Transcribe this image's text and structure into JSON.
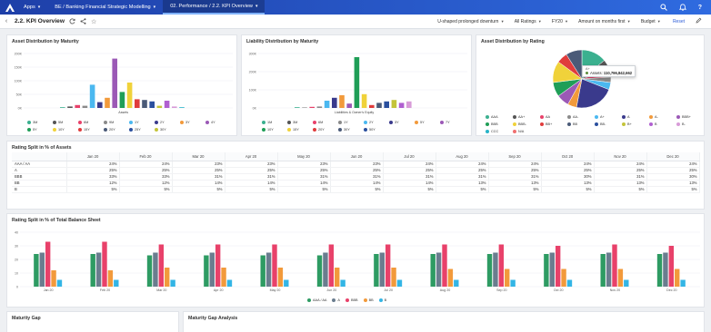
{
  "topbar": {
    "apps_label": "Apps",
    "breadcrumb_1": "BE / Banking Financial Strategic Modelling",
    "breadcrumb_2": "02. Performance / 2.2. KPI Overview",
    "icons": [
      "search-icon",
      "bell-icon",
      "help-icon"
    ]
  },
  "toolbar": {
    "title": "2.2. KPI Overview",
    "filters": [
      "U-shaped prolonged downturn",
      "All Ratings",
      "FY20",
      "Amount on months first",
      "Budget"
    ],
    "reset_label": "Reset"
  },
  "colors": {
    "palette": [
      "#3bb08f",
      "#555555",
      "#e8416a",
      "#8a8a8a",
      "#4bb8f0",
      "#3a3a8c",
      "#f29a3b",
      "#9b59b6",
      "#1f9e57",
      "#f0d23a",
      "#e03c3c",
      "#4a5a78",
      "#2a4f9e",
      "#c4c43a",
      "#b05fd0",
      "#d89bd8",
      "#28b4c8",
      "#f07070"
    ],
    "balance": [
      "#2e9b63",
      "#6a7d8f",
      "#e8416a",
      "#f29a3b",
      "#33b5e5"
    ]
  },
  "asset_maturity": {
    "title": "Asset Distribution by Maturity",
    "y_ticks": [
      "200K",
      "150K",
      "100K",
      "50K",
      "0K"
    ],
    "x_label": "Assets",
    "values": [
      1,
      2,
      4,
      3,
      32,
      8,
      14,
      68,
      22,
      35,
      12,
      11,
      9,
      3,
      10,
      2,
      1
    ],
    "legend": [
      "3M",
      "5M",
      "6M",
      "9M",
      "1Y",
      "2Y",
      "3Y",
      "4Y",
      "5Y",
      "10Y",
      "15Y",
      "20Y",
      "25Y",
      "30Y"
    ]
  },
  "liability_maturity": {
    "title": "Liability Distribution by Maturity",
    "y_ticks": [
      "300K",
      "200K",
      "100K",
      "0K"
    ],
    "x_label": "Liabilities & Owner's Equity",
    "values": [
      2,
      1,
      3,
      4,
      20,
      28,
      35,
      12,
      140,
      38,
      8,
      14,
      18,
      22,
      14,
      18
    ],
    "legend": [
      "1M",
      "3M",
      "6M",
      "1Y",
      "2Y",
      "3Y",
      "5Y",
      "7Y",
      "10Y",
      "15Y",
      "20Y",
      "30Y",
      "50Y"
    ]
  },
  "asset_rating": {
    "title": "Asset Distribution by Rating",
    "slices": [
      14,
      6,
      4,
      3,
      4,
      22,
      5,
      7,
      8,
      12,
      6,
      9
    ],
    "legend": [
      "AAA",
      "AA+",
      "AA",
      "AA-",
      "A+",
      "A",
      "A-",
      "BBB+",
      "BBB",
      "BBB-",
      "BB+",
      "BB",
      "BB-",
      "B+",
      "B",
      "B-",
      "CCC",
      "N/A"
    ],
    "tooltip_head": "A+",
    "tooltip_label": "Assets:",
    "tooltip_value": "110,796,842,662"
  },
  "rating_split_assets": {
    "title": "Rating Split in % of Assets",
    "columns": [
      "Jan 20",
      "Feb 20",
      "Mar 20",
      "Apr 20",
      "May 20",
      "Jun 20",
      "Jul 20",
      "Aug 20",
      "Sep 20",
      "Oct 20",
      "Nov 20",
      "Dec 20"
    ],
    "rows": [
      {
        "label": "AAA / AA",
        "values": [
          "24%",
          "24%",
          "23%",
          "23%",
          "23%",
          "23%",
          "24%",
          "24%",
          "24%",
          "24%",
          "24%",
          "24%"
        ]
      },
      {
        "label": "A",
        "values": [
          "25%",
          "25%",
          "25%",
          "25%",
          "25%",
          "25%",
          "25%",
          "25%",
          "25%",
          "25%",
          "25%",
          "25%"
        ]
      },
      {
        "label": "BBB",
        "values": [
          "33%",
          "33%",
          "31%",
          "31%",
          "31%",
          "31%",
          "31%",
          "31%",
          "31%",
          "30%",
          "31%",
          "30%"
        ]
      },
      {
        "label": "BB",
        "values": [
          "12%",
          "12%",
          "14%",
          "14%",
          "14%",
          "14%",
          "14%",
          "13%",
          "13%",
          "13%",
          "13%",
          "13%"
        ]
      },
      {
        "label": "B",
        "values": [
          "5%",
          "5%",
          "5%",
          "5%",
          "5%",
          "5%",
          "5%",
          "5%",
          "5%",
          "5%",
          "5%",
          "5%"
        ]
      }
    ]
  },
  "balance_sheet": {
    "title": "Rating Split in % of Total Balance Sheet",
    "y_ticks": [
      "40",
      "30",
      "20",
      "10",
      "0"
    ],
    "ylim": [
      0,
      40
    ],
    "legend": [
      "AAA / AA",
      "A",
      "BBB",
      "BB",
      "B"
    ]
  },
  "chart_data": {
    "type": "bar",
    "title": "Rating Split in % of Total Balance Sheet",
    "categories": [
      "Jan 20",
      "Feb 20",
      "Mar 20",
      "Apr 20",
      "May 20",
      "Jun 20",
      "Jul 20",
      "Aug 20",
      "Sep 20",
      "Oct 20",
      "Nov 20",
      "Dec 20"
    ],
    "ylim": [
      0,
      40
    ],
    "series": [
      {
        "name": "AAA / AA",
        "values": [
          24,
          24,
          23,
          23,
          23,
          23,
          24,
          24,
          24,
          24,
          24,
          24
        ]
      },
      {
        "name": "A",
        "values": [
          25,
          25,
          25,
          25,
          25,
          25,
          25,
          25,
          25,
          25,
          25,
          25
        ]
      },
      {
        "name": "BBB",
        "values": [
          33,
          33,
          31,
          31,
          31,
          31,
          31,
          31,
          31,
          30,
          31,
          30
        ]
      },
      {
        "name": "BB",
        "values": [
          12,
          12,
          14,
          14,
          14,
          14,
          14,
          13,
          13,
          13,
          13,
          13
        ]
      },
      {
        "name": "B",
        "values": [
          5,
          5,
          5,
          5,
          5,
          5,
          5,
          5,
          5,
          5,
          5,
          5
        ]
      }
    ]
  },
  "bottom": {
    "maturity_gap": "Maturity Gap",
    "maturity_gap_analysis": "Maturity Gap Analysis"
  }
}
